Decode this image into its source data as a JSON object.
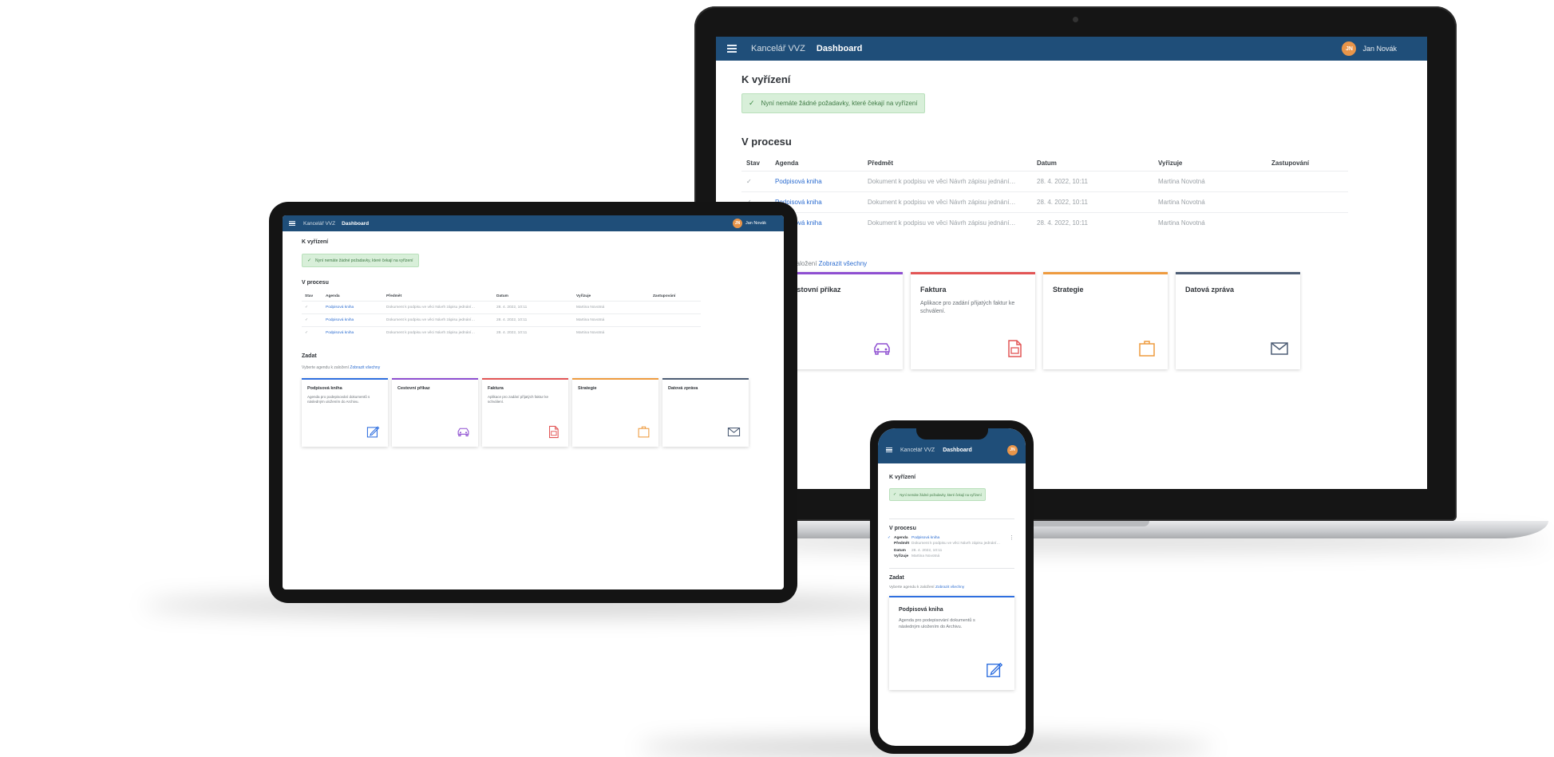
{
  "app": {
    "title": "Kancelář VVZ",
    "page": "Dashboard",
    "user_initials": "JN",
    "user_name": "Jan Novák"
  },
  "sections": {
    "todo_title": "K vyřízení",
    "todo_message": "Nyní nemáte žádné požadavky, které čekají na vyřízení",
    "in_progress_title": "V procesu",
    "create_title": "Zadat",
    "create_text": "Vyberte agendu k založení",
    "create_link": "Zobrazit všechny"
  },
  "table": {
    "headers": [
      "Stav",
      "Agenda",
      "Předmět",
      "Datum",
      "Vyřizuje",
      "Zastupování"
    ],
    "rows": [
      {
        "state": "✓",
        "agenda": "Podpisová kniha",
        "subject": "Dokument k podpisu ve věci Návrh zápisu jednání…",
        "date": "28. 4. 2022, 10:11",
        "handler": "Martina Novotná",
        "deputy": ""
      },
      {
        "state": "✓",
        "agenda": "Podpisová kniha",
        "subject": "Dokument k podpisu ve věci Návrh zápisu jednání…",
        "date": "28. 4. 2022, 10:11",
        "handler": "Martina Novotná",
        "deputy": ""
      },
      {
        "state": "✓",
        "agenda": "Podpisová kniha",
        "subject": "Dokument k podpisu ve věci Návrh zápisu jednání…",
        "date": "28. 4. 2022, 10:11",
        "handler": "Martina Novotná",
        "deputy": ""
      }
    ]
  },
  "mobile_item": {
    "agenda_label": "Agenda",
    "agenda_value": "Podpisová kniha",
    "subject_label": "Předmět",
    "subject_value": "Dokument k podpisu ve věci Návrh zápisu jednání…",
    "date_label": "Datum",
    "date_value": "28. 4. 2022, 10:11",
    "handler_label": "Vyřizuje",
    "handler_value": "Martina Novotná"
  },
  "tiles": [
    {
      "title": "Podpisová kniha",
      "desc": "Agenda pro podepisování dokumentů s následným uložením do Archivu.",
      "icon": "edit-icon",
      "color": "#2f6fdf"
    },
    {
      "title": "Cestovní příkaz",
      "desc": "",
      "icon": "car-icon",
      "color": "#8e4fd1"
    },
    {
      "title": "Faktura",
      "desc": "Aplikace pro zadání přijatých faktur ke schválení.",
      "icon": "invoice-icon",
      "color": "#e25555"
    },
    {
      "title": "Strategie",
      "desc": "",
      "icon": "briefcase-icon",
      "color": "#ee9b3f"
    },
    {
      "title": "Datová zpráva",
      "desc": "",
      "icon": "envelope-icon",
      "color": "#4d5d75"
    }
  ],
  "colors": {
    "appbar": "#1f4e79",
    "link": "#2b6cd0",
    "success_bg": "#d8efd9",
    "avatar": "#e8954a"
  }
}
